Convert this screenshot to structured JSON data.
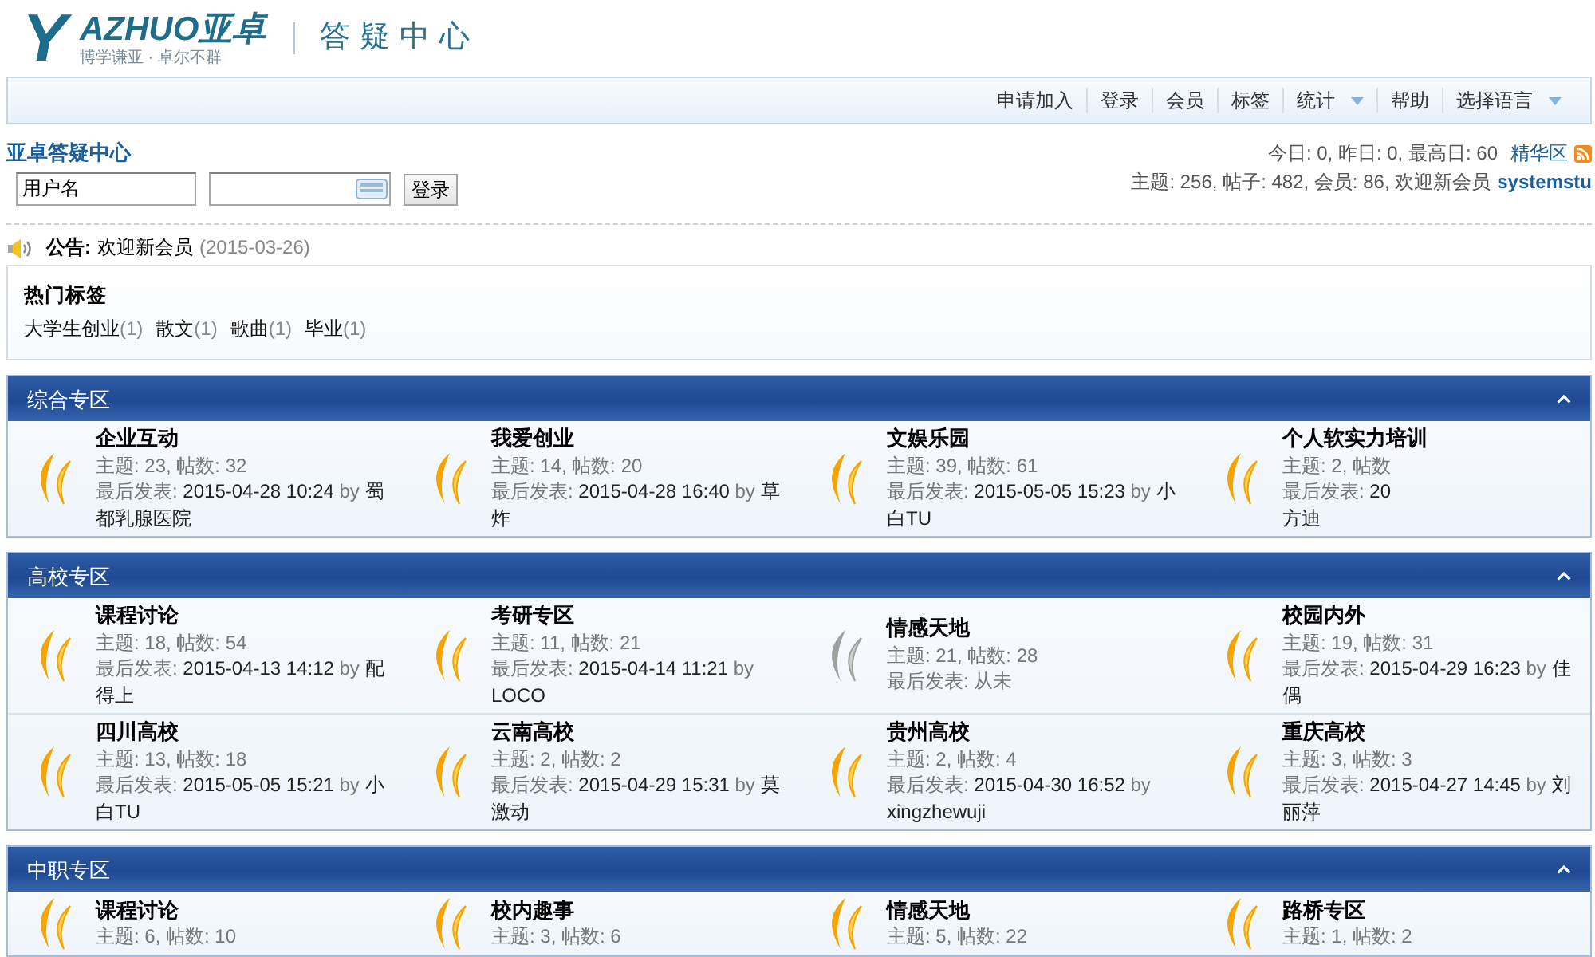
{
  "header": {
    "logo": {
      "letter": "Y",
      "wordmark": "AZHUO亚卓",
      "slogan": "博学谦亚 · 卓尔不群"
    },
    "title": "答疑中心"
  },
  "nav": [
    {
      "label": "申请加入",
      "menu": false
    },
    {
      "label": "登录",
      "menu": false
    },
    {
      "label": "会员",
      "menu": false
    },
    {
      "label": "标签",
      "menu": false
    },
    {
      "label": "统计",
      "menu": true
    },
    {
      "label": "帮助",
      "menu": false
    },
    {
      "label": "选择语言",
      "menu": true
    }
  ],
  "login": {
    "site_name": "亚卓答疑中心",
    "username": "用户名",
    "button": "登录"
  },
  "stats": {
    "today": "今日: 0, 昨日: 0, 最高日: 60",
    "digest_link": "精华区",
    "totals": "主题: 256, 帖子: 482, 会员: 86, 欢迎新会员",
    "newest_member": "systemstu"
  },
  "announcement": {
    "label": "公告:",
    "text": "欢迎新会员",
    "date": "(2015-03-26)"
  },
  "hot_tags": {
    "title": "热门标签",
    "tags": [
      {
        "name": "大学生创业",
        "count": "(1)"
      },
      {
        "name": "散文",
        "count": "(1)"
      },
      {
        "name": "歌曲",
        "count": "(1)"
      },
      {
        "name": "毕业",
        "count": "(1)"
      }
    ]
  },
  "sections": [
    {
      "title": "综合专区",
      "forums": [
        {
          "name": "企业互动",
          "new": true,
          "stats": "主题: 23, 帖数: 32",
          "last_post": {
            "kind": "post",
            "label": "最后发表:",
            "time": "2015-04-28 10:24",
            "by": "by",
            "author": "蜀都乳腺医院"
          }
        },
        {
          "name": "我爱创业",
          "new": true,
          "stats": "主题: 14, 帖数: 20",
          "last_post": {
            "kind": "post",
            "label": "最后发表:",
            "time": "2015-04-28 16:40",
            "by": "by",
            "author": "草炸"
          }
        },
        {
          "name": "文娱乐园",
          "new": true,
          "stats": "主题: 39, 帖数: 61",
          "last_post": {
            "kind": "post",
            "label": "最后发表:",
            "time": "2015-05-05 15:23",
            "by": "by",
            "author": "小白TU"
          }
        },
        {
          "name": "个人软实力培训",
          "new": true,
          "stats": "主题: 2, 帖数",
          "last_post": {
            "kind": "post",
            "label": "最后发表:",
            "time": "20",
            "author": "方迪"
          }
        }
      ]
    },
    {
      "title": "高校专区",
      "forums": [
        {
          "name": "课程讨论",
          "new": true,
          "stats": "主题: 18, 帖数: 54",
          "last_post": {
            "kind": "post",
            "label": "最后发表:",
            "time": "2015-04-13 14:12",
            "by": "by",
            "author": "配得上"
          }
        },
        {
          "name": "考研专区",
          "new": true,
          "stats": "主题: 11, 帖数: 21",
          "last_post": {
            "kind": "post",
            "label": "最后发表:",
            "time": "2015-04-14 11:21",
            "by": "by",
            "author": "LOCO"
          }
        },
        {
          "name": "情感天地",
          "new": false,
          "stats": "主题: 21, 帖数: 28",
          "last_post": {
            "kind": "never",
            "label": "最后发表:",
            "time": "从未"
          }
        },
        {
          "name": "校园内外",
          "new": true,
          "stats": "主题: 19, 帖数: 31",
          "last_post": {
            "kind": "post",
            "label": "最后发表:",
            "time": "2015-04-29 16:23",
            "by": "by",
            "author": "佳偶"
          }
        },
        {
          "name": "四川高校",
          "new": true,
          "stats": "主题: 13, 帖数: 18",
          "last_post": {
            "kind": "post",
            "label": "最后发表:",
            "time": "2015-05-05 15:21",
            "by": "by",
            "author": "小白TU"
          }
        },
        {
          "name": "云南高校",
          "new": true,
          "stats": "主题: 2, 帖数: 2",
          "last_post": {
            "kind": "post",
            "label": "最后发表:",
            "time": "2015-04-29 15:31",
            "by": "by",
            "author": "莫激动"
          }
        },
        {
          "name": "贵州高校",
          "new": true,
          "stats": "主题: 2, 帖数: 4",
          "last_post": {
            "kind": "post",
            "label": "最后发表:",
            "time": "2015-04-30 16:52",
            "by": "by",
            "author": "xingzhewuji"
          }
        },
        {
          "name": "重庆高校",
          "new": true,
          "stats": "主题: 3, 帖数: 3",
          "last_post": {
            "kind": "post",
            "label": "最后发表:",
            "time": "2015-04-27 14:45",
            "by": "by",
            "author": "刘丽萍"
          }
        }
      ]
    },
    {
      "title": "中职专区",
      "forums": [
        {
          "name": "课程讨论",
          "new": true,
          "stats": "主题: 6, 帖数: 10"
        },
        {
          "name": "校内趣事",
          "new": true,
          "stats": "主题: 3, 帖数: 6"
        },
        {
          "name": "情感天地",
          "new": true,
          "stats": "主题: 5, 帖数: 22"
        },
        {
          "name": "路桥专区",
          "new": true,
          "stats": "主题: 1, 帖数: 2"
        }
      ]
    }
  ]
}
